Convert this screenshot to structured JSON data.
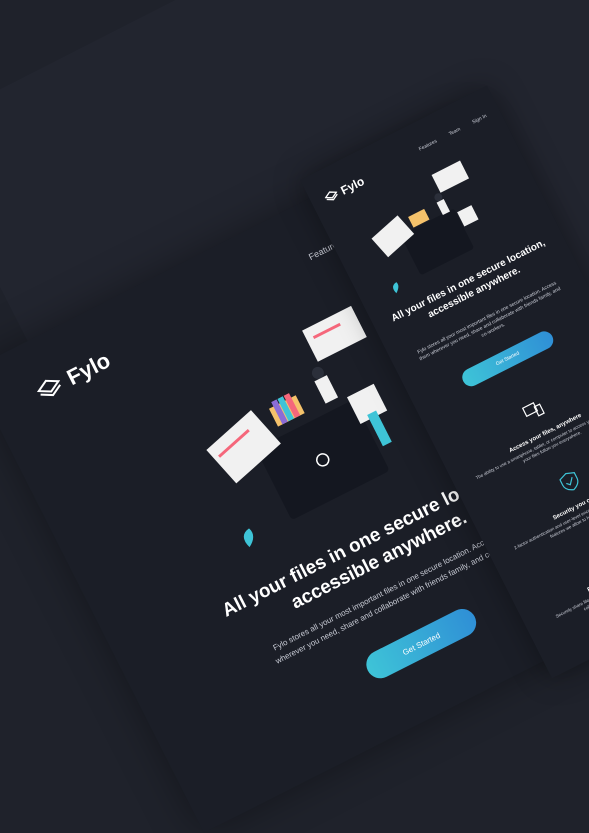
{
  "brand": {
    "name": "Fylo"
  },
  "nav": {
    "items": [
      "Features",
      "Team",
      "Sign In"
    ]
  },
  "hero": {
    "title": "All your files in one secure location, accessible anywhere.",
    "subtitle": "Fylo stores all your most important files in one secure location. Access them wherever you need, share and collaborate with friends family, and co-workers.",
    "cta": "Get Started"
  },
  "features": [
    {
      "title": "Access your files, anywhere",
      "desc": "The ability to use a smartphone, tablet, or computer to access your account means your files follow you everywhere."
    },
    {
      "title": "Security you can trust",
      "desc": "2-factor authentication and user-level encryption are just a couple of the security features we allow to help secure your files."
    },
    {
      "title": "Real-time collaboration",
      "desc": "Securely share files and folders with friends, family and colleagues for live collaboration. No email attachments required."
    }
  ],
  "colors": {
    "background": "#1f222b",
    "surface": "#1b1e27",
    "accent_start": "#3ec4d7",
    "accent_end": "#2f8fd6",
    "pink": "#f5677b"
  }
}
